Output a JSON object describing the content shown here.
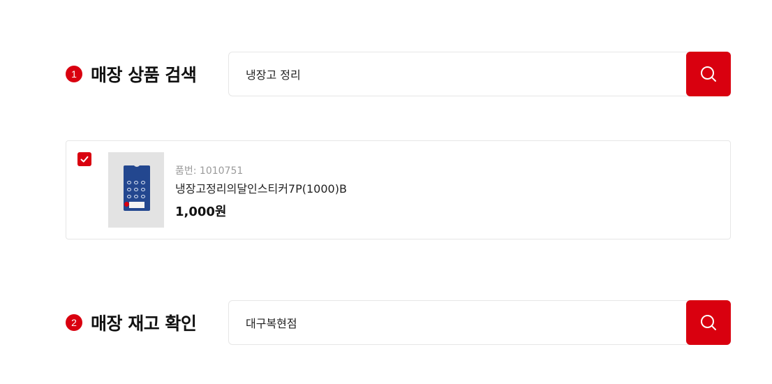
{
  "store_product_search": {
    "step_number": "1",
    "title": "매장 상품 검색",
    "search_value": "냉장고 정리",
    "search_icon": "search-icon"
  },
  "search_result": {
    "checked": true,
    "product_code_label": "품번: 1010751",
    "product_name": "냉장고정리의달인스티커7P(1000)B",
    "price": "1,000원",
    "thumbnail": "product-thumbnail"
  },
  "store_stock_check": {
    "step_number": "2",
    "title": "매장 재고 확인",
    "search_value": "대구복현점",
    "search_icon": "search-icon"
  },
  "colors": {
    "accent": "#d9000f",
    "border": "#e6e6e6",
    "muted_text": "#9a9a9a"
  }
}
